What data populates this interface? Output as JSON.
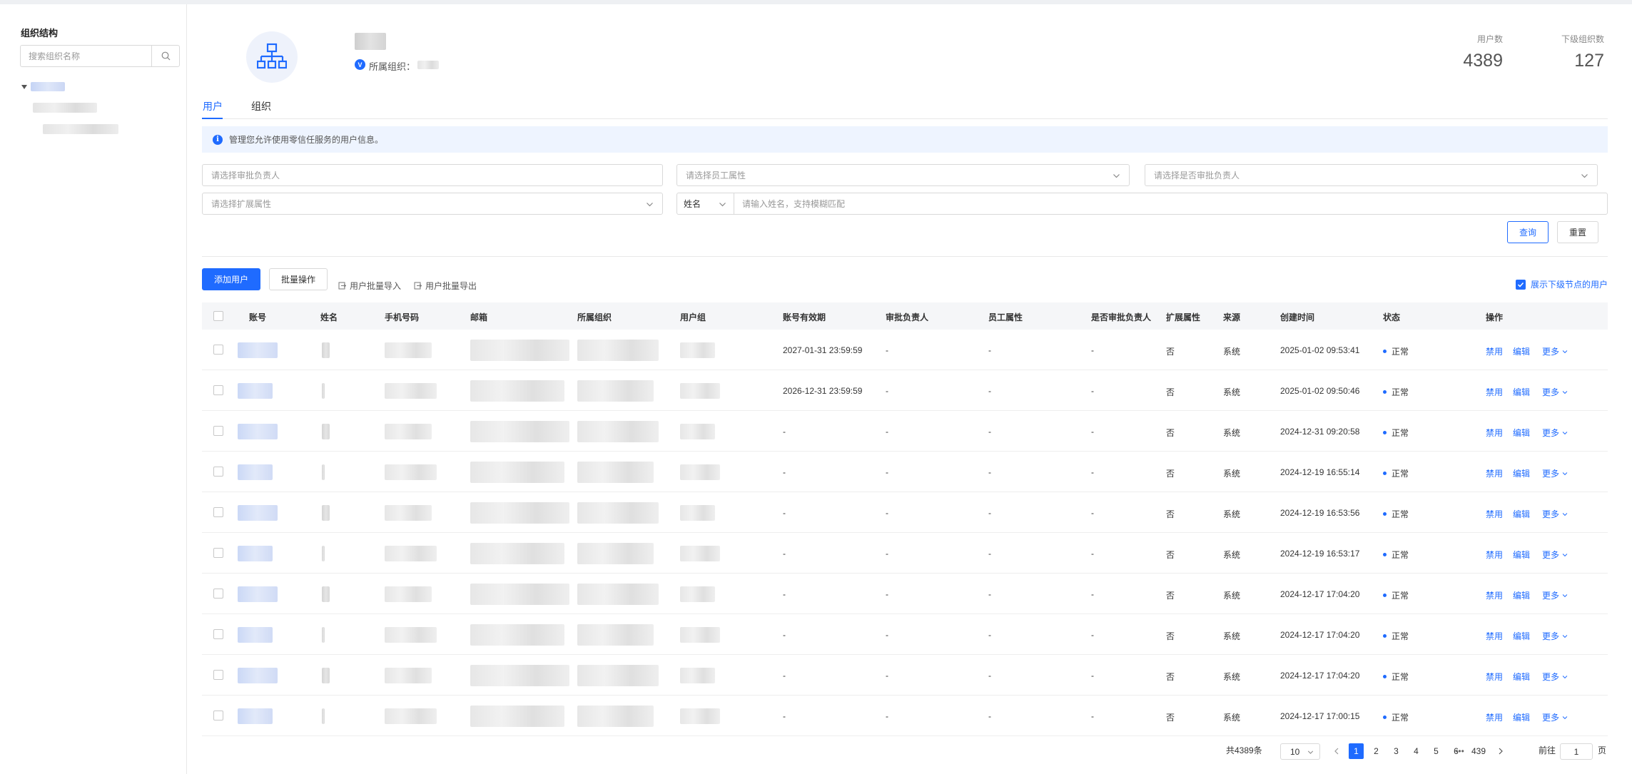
{
  "sidebar": {
    "title": "组织结构",
    "search_placeholder": "搜索组织名称"
  },
  "org": {
    "belongs_label": "所属组织：",
    "badge": "V",
    "stats": [
      {
        "label": "用户数",
        "value": "4389"
      },
      {
        "label": "下级组织数",
        "value": "127"
      }
    ]
  },
  "tabs": [
    {
      "label": "用户",
      "active": true
    },
    {
      "label": "组织",
      "active": false
    }
  ],
  "alert": {
    "icon": "info-icon",
    "text": "管理您允许使用零信任服务的用户信息。"
  },
  "filters": {
    "approver": "请选择审批负责人",
    "employee_attr": "请选择员工属性",
    "is_approver": "请选择是否审批负责人",
    "ext_attr": "请选择扩展属性",
    "name_select": "姓名",
    "name_input_placeholder": "请输入姓名，支持模糊匹配"
  },
  "buttons": {
    "query": "查询",
    "reset": "重置",
    "add_user": "添加用户",
    "batch": "批量操作",
    "import": "用户批量导入",
    "export": "用户批量导出",
    "show_sub": "展示下级节点的用户"
  },
  "table": {
    "headers": [
      "账号",
      "姓名",
      "手机号码",
      "邮箱",
      "所属组织",
      "用户组",
      "账号有效期",
      "审批负责人",
      "员工属性",
      "是否审批负责人",
      "扩展属性",
      "来源",
      "创建时间",
      "状态",
      "操作"
    ],
    "actions": {
      "disable": "禁用",
      "edit": "编辑",
      "more": "更多"
    },
    "rows": [
      {
        "expiry": "2027-01-31 23:59:59",
        "approver": "-",
        "emp_attr": "-",
        "is_approver": "-",
        "ext": "否",
        "source": "系统",
        "created": "2025-01-02 09:53:41",
        "status": "正常"
      },
      {
        "expiry": "2026-12-31 23:59:59",
        "approver": "-",
        "emp_attr": "-",
        "is_approver": "-",
        "ext": "否",
        "source": "系统",
        "created": "2025-01-02 09:50:46",
        "status": "正常"
      },
      {
        "expiry": "-",
        "approver": "-",
        "emp_attr": "-",
        "is_approver": "-",
        "ext": "否",
        "source": "系统",
        "created": "2024-12-31 09:20:58",
        "status": "正常"
      },
      {
        "expiry": "-",
        "approver": "-",
        "emp_attr": "-",
        "is_approver": "-",
        "ext": "否",
        "source": "系统",
        "created": "2024-12-19 16:55:14",
        "status": "正常"
      },
      {
        "expiry": "-",
        "approver": "-",
        "emp_attr": "-",
        "is_approver": "-",
        "ext": "否",
        "source": "系统",
        "created": "2024-12-19 16:53:56",
        "status": "正常"
      },
      {
        "expiry": "-",
        "approver": "-",
        "emp_attr": "-",
        "is_approver": "-",
        "ext": "否",
        "source": "系统",
        "created": "2024-12-19 16:53:17",
        "status": "正常"
      },
      {
        "expiry": "-",
        "approver": "-",
        "emp_attr": "-",
        "is_approver": "-",
        "ext": "否",
        "source": "系统",
        "created": "2024-12-17 17:04:20",
        "status": "正常"
      },
      {
        "expiry": "-",
        "approver": "-",
        "emp_attr": "-",
        "is_approver": "-",
        "ext": "否",
        "source": "系统",
        "created": "2024-12-17 17:04:20",
        "status": "正常"
      },
      {
        "expiry": "-",
        "approver": "-",
        "emp_attr": "-",
        "is_approver": "-",
        "ext": "否",
        "source": "系统",
        "created": "2024-12-17 17:04:20",
        "status": "正常"
      },
      {
        "expiry": "-",
        "approver": "-",
        "emp_attr": "-",
        "is_approver": "-",
        "ext": "否",
        "source": "系统",
        "created": "2024-12-17 17:00:15",
        "status": "正常"
      }
    ]
  },
  "pagination": {
    "total": "共4389条",
    "page_size": "10",
    "pages": [
      "1",
      "2",
      "3",
      "4",
      "5",
      "6"
    ],
    "current": "1",
    "ellipsis": "•••",
    "last": "439",
    "goto_label": "前往",
    "goto_value": "1",
    "page_suffix": "页"
  },
  "colors": {
    "primary": "#1f6bff",
    "alert_bg": "#eef4ff",
    "header_bg": "#f5f6f8"
  }
}
